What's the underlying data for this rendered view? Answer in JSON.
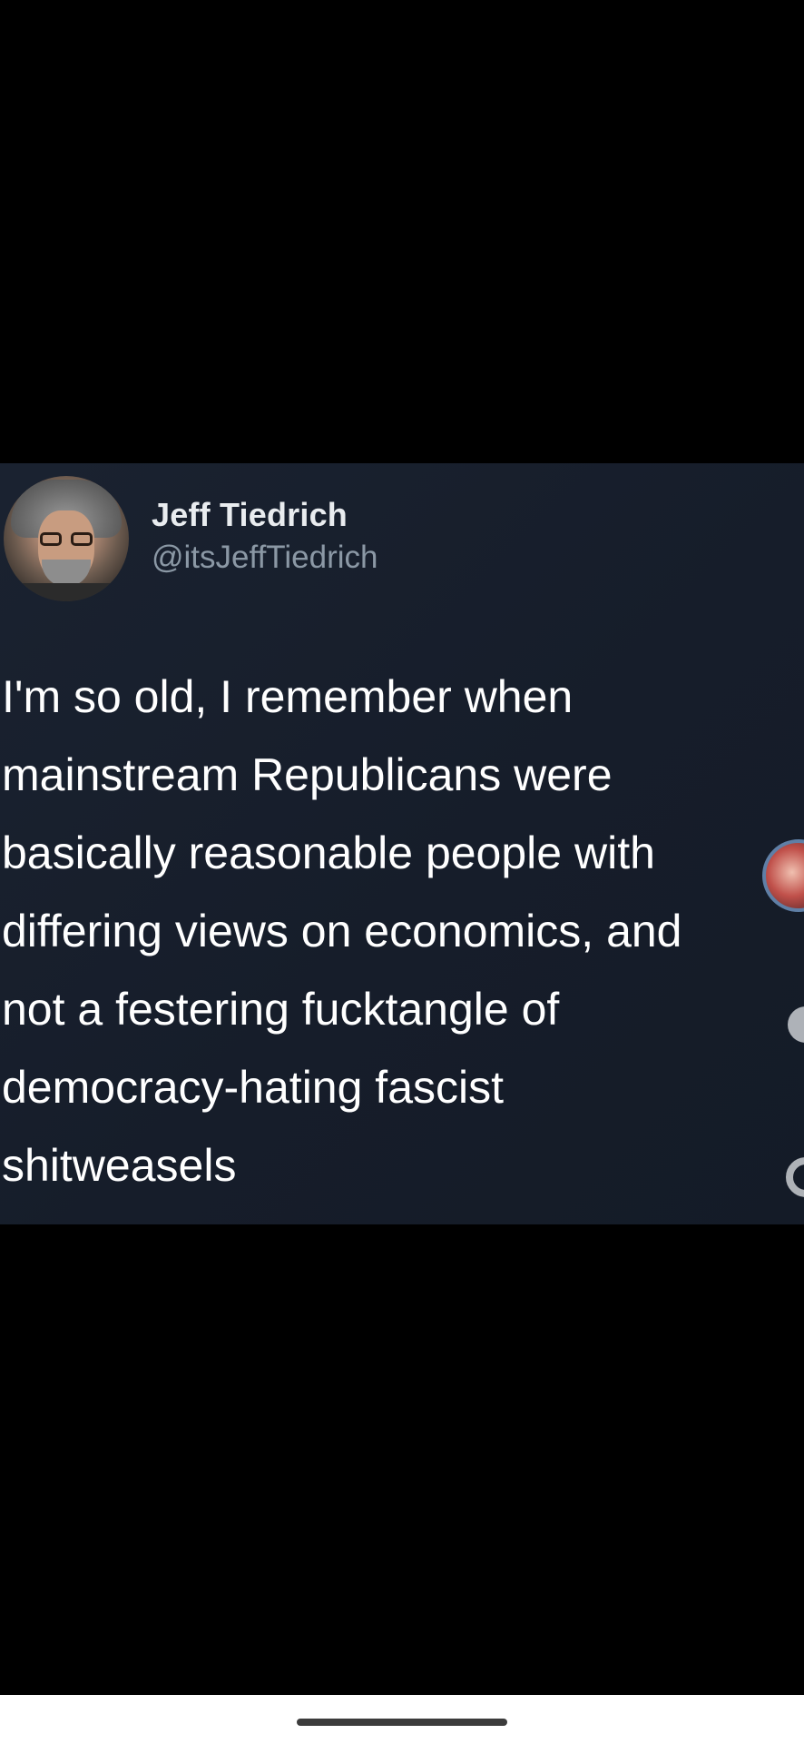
{
  "tweet": {
    "display_name": "Jeff Tiedrich",
    "handle": "@itsJeffTiedrich",
    "text_lines": [
      "I'm so old, I remember when",
      "mainstream Republicans were",
      "basically reasonable people with",
      "differing views on economics, and",
      "not a festering fucktangle of",
      "democracy-hating fascist",
      "shitweasels"
    ]
  },
  "colors": {
    "background": "#000000",
    "card": "#161d2a",
    "name_text": "#e9ecef",
    "handle_text": "#8b98a5",
    "body_text": "#ffffff",
    "home_bar": "#ffffff"
  },
  "icons": [
    "avatar",
    "side-profile-bubble",
    "side-like-icon",
    "side-share-icon",
    "home-indicator"
  ]
}
